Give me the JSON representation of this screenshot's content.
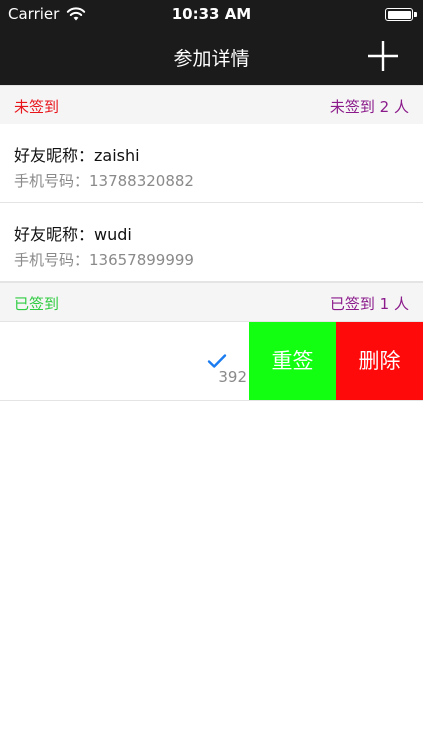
{
  "statusbar": {
    "carrier": "Carrier",
    "time": "10:33 AM",
    "battery_level": 1.0
  },
  "navbar": {
    "title": "参加详情",
    "add_icon": "plus-icon"
  },
  "unsigned_section": {
    "label": "未签到",
    "summary": "未签到 2 人",
    "label_color": "#e8151b"
  },
  "unsigned_rows": [
    {
      "nickname": "好友昵称：zaishi",
      "phone": "手机号码：13788320882"
    },
    {
      "nickname": "好友昵称：wudi",
      "phone": "手机号码：13657899999"
    }
  ],
  "signed_section": {
    "label": "已签到",
    "summary": "已签到 1 人",
    "label_color": "#2ecc40"
  },
  "signed_row": {
    "nickname": "",
    "phone": "392",
    "check_icon": "checkmark-icon"
  },
  "swipe_actions": {
    "resign_label": "重签",
    "delete_label": "删除",
    "resign_color": "#12ff12",
    "delete_color": "#ff0a0a"
  }
}
